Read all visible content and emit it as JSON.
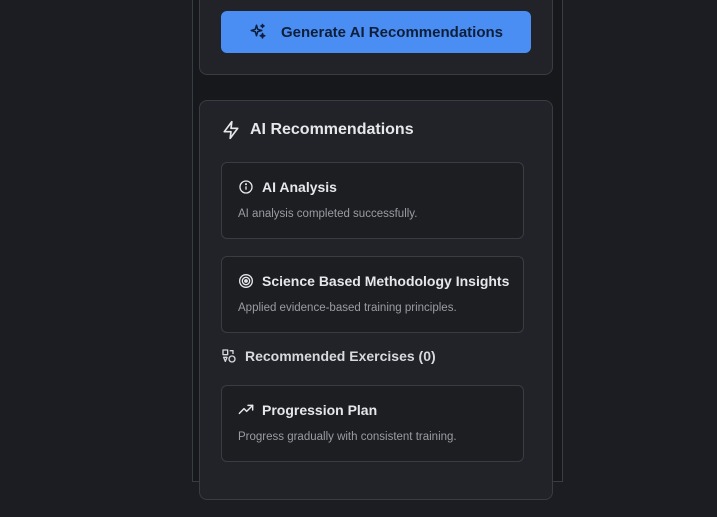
{
  "generate": {
    "label": "Generate AI Recommendations",
    "icon": "sparkles-icon"
  },
  "recommendations": {
    "title": "AI Recommendations",
    "icon": "lightning-icon",
    "analysis": {
      "title": "AI Analysis",
      "icon": "info-circle-icon",
      "description": "AI analysis completed successfully."
    },
    "methodology": {
      "title": "Science Based Methodology Insights",
      "icon": "target-icon",
      "description": "Applied evidence-based training principles."
    },
    "exercises": {
      "label": "Recommended Exercises (0)",
      "icon": "shapes-icon"
    },
    "progression": {
      "title": "Progression Plan",
      "icon": "trending-up-icon",
      "description": "Progress gradually with consistent training."
    }
  },
  "colors": {
    "accent": "#4a8ef3",
    "background": "#1c1d22",
    "card": "#212328",
    "border": "#3a3c43"
  }
}
